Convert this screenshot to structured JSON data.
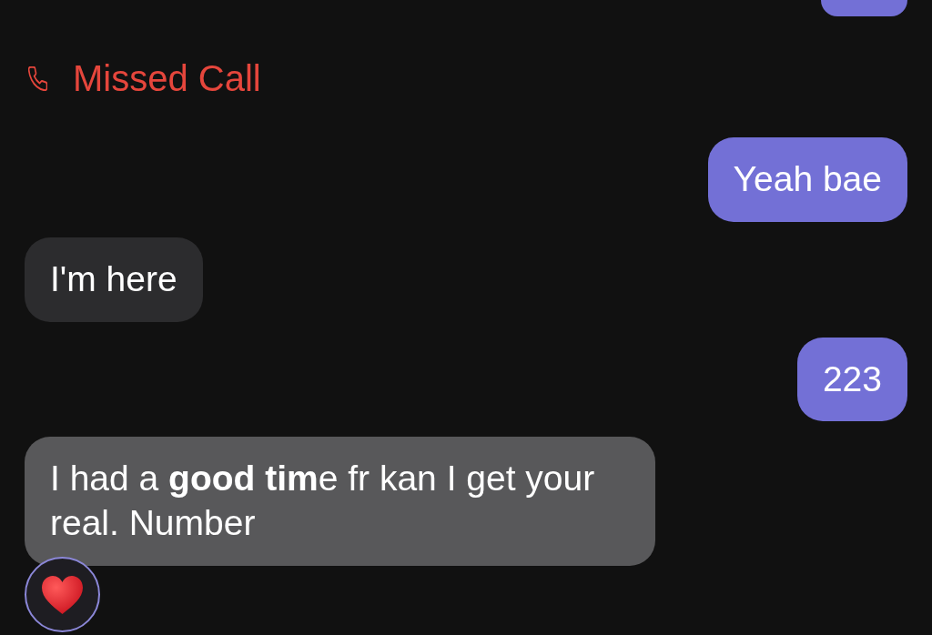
{
  "messages": [
    {
      "kind": "clipped",
      "sent": true
    },
    {
      "kind": "missed-call",
      "label": "Missed Call"
    },
    {
      "kind": "text",
      "sent": true,
      "text": "Yeah bae",
      "highlighted": false,
      "reacted": false
    },
    {
      "kind": "text",
      "sent": false,
      "text": "I'm here",
      "highlighted": false,
      "reacted": false
    },
    {
      "kind": "text",
      "sent": true,
      "text": "223",
      "highlighted": false,
      "reacted": false
    },
    {
      "kind": "text",
      "sent": false,
      "text": "I had a **good tim**e fr kan I get your real. Number",
      "highlighted": true,
      "reacted": true
    }
  ]
}
